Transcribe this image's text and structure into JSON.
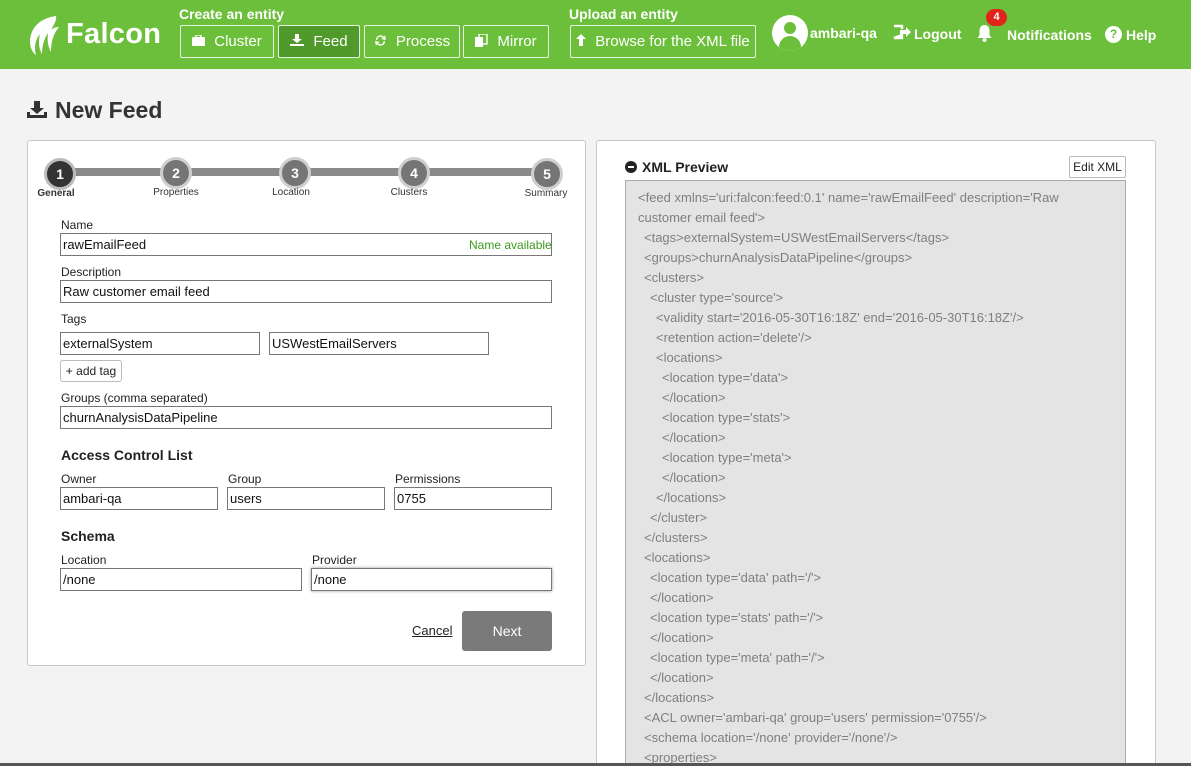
{
  "header": {
    "app_name": "Falcon",
    "create_title": "Create an entity",
    "upload_title": "Upload an entity",
    "buttons": [
      {
        "label": "Cluster",
        "icon": "briefcase-icon"
      },
      {
        "label": "Feed",
        "icon": "download-icon",
        "active": true
      },
      {
        "label": "Process",
        "icon": "sync-icon"
      },
      {
        "label": "Mirror",
        "icon": "copy-icon"
      }
    ],
    "browse_label": "Browse for the XML file",
    "user": "ambari-qa",
    "logout": "Logout",
    "notifications": "Notifications",
    "notification_count": "4",
    "help": "Help",
    "colors": {
      "bar": "#6cbf3a",
      "active_button": "#4f9a2a"
    }
  },
  "page_title": "New Feed",
  "wizard": {
    "steps": [
      {
        "num": "1",
        "label": "General",
        "active": true
      },
      {
        "num": "2",
        "label": "Properties"
      },
      {
        "num": "3",
        "label": "Location"
      },
      {
        "num": "4",
        "label": "Clusters"
      },
      {
        "num": "5",
        "label": "Summary"
      }
    ]
  },
  "form": {
    "name_label": "Name",
    "name_value": "rawEmailFeed",
    "name_status": "Name available",
    "description_label": "Description",
    "description_value": "Raw customer email feed",
    "tags_label": "Tags",
    "tag_key": "externalSystem",
    "tag_value": "USWestEmailServers",
    "add_tag_label": "+ add tag",
    "groups_label": "Groups (comma separated)",
    "groups_value": "churnAnalysisDataPipeline",
    "acl_title": "Access Control List",
    "owner_label": "Owner",
    "owner_value": "ambari-qa",
    "group_label": "Group",
    "group_value": "users",
    "permissions_label": "Permissions",
    "permissions_value": "0755",
    "schema_title": "Schema",
    "location_label": "Location",
    "location_value": "/none",
    "provider_label": "Provider",
    "provider_value": "/none",
    "cancel_label": "Cancel",
    "next_label": "Next"
  },
  "xml_preview": {
    "title": "XML Preview",
    "edit_label": "Edit XML",
    "lines": [
      "<feed xmlns='uri:falcon:feed:0.1' name='rawEmailFeed' description='Raw",
      "customer email feed'>",
      "  <tags>externalSystem=USWestEmailServers</tags>",
      "  <groups>churnAnalysisDataPipeline</groups>",
      "  <clusters>",
      "    <cluster type='source'>",
      "      <validity start='2016-05-30T16:18Z' end='2016-05-30T16:18Z'/>",
      "      <retention action='delete'/>",
      "      <locations>",
      "        <location type='data'>",
      "        </location>",
      "        <location type='stats'>",
      "        </location>",
      "        <location type='meta'>",
      "        </location>",
      "      </locations>",
      "    </cluster>",
      "  </clusters>",
      "  <locations>",
      "    <location type='data' path='/'>",
      "    </location>",
      "    <location type='stats' path='/'>",
      "    </location>",
      "    <location type='meta' path='/'>",
      "    </location>",
      "  </locations>",
      "  <ACL owner='ambari-qa' group='users' permission='0755'/>",
      "  <schema location='/none' provider='/none'/>",
      "  <properties>"
    ]
  }
}
